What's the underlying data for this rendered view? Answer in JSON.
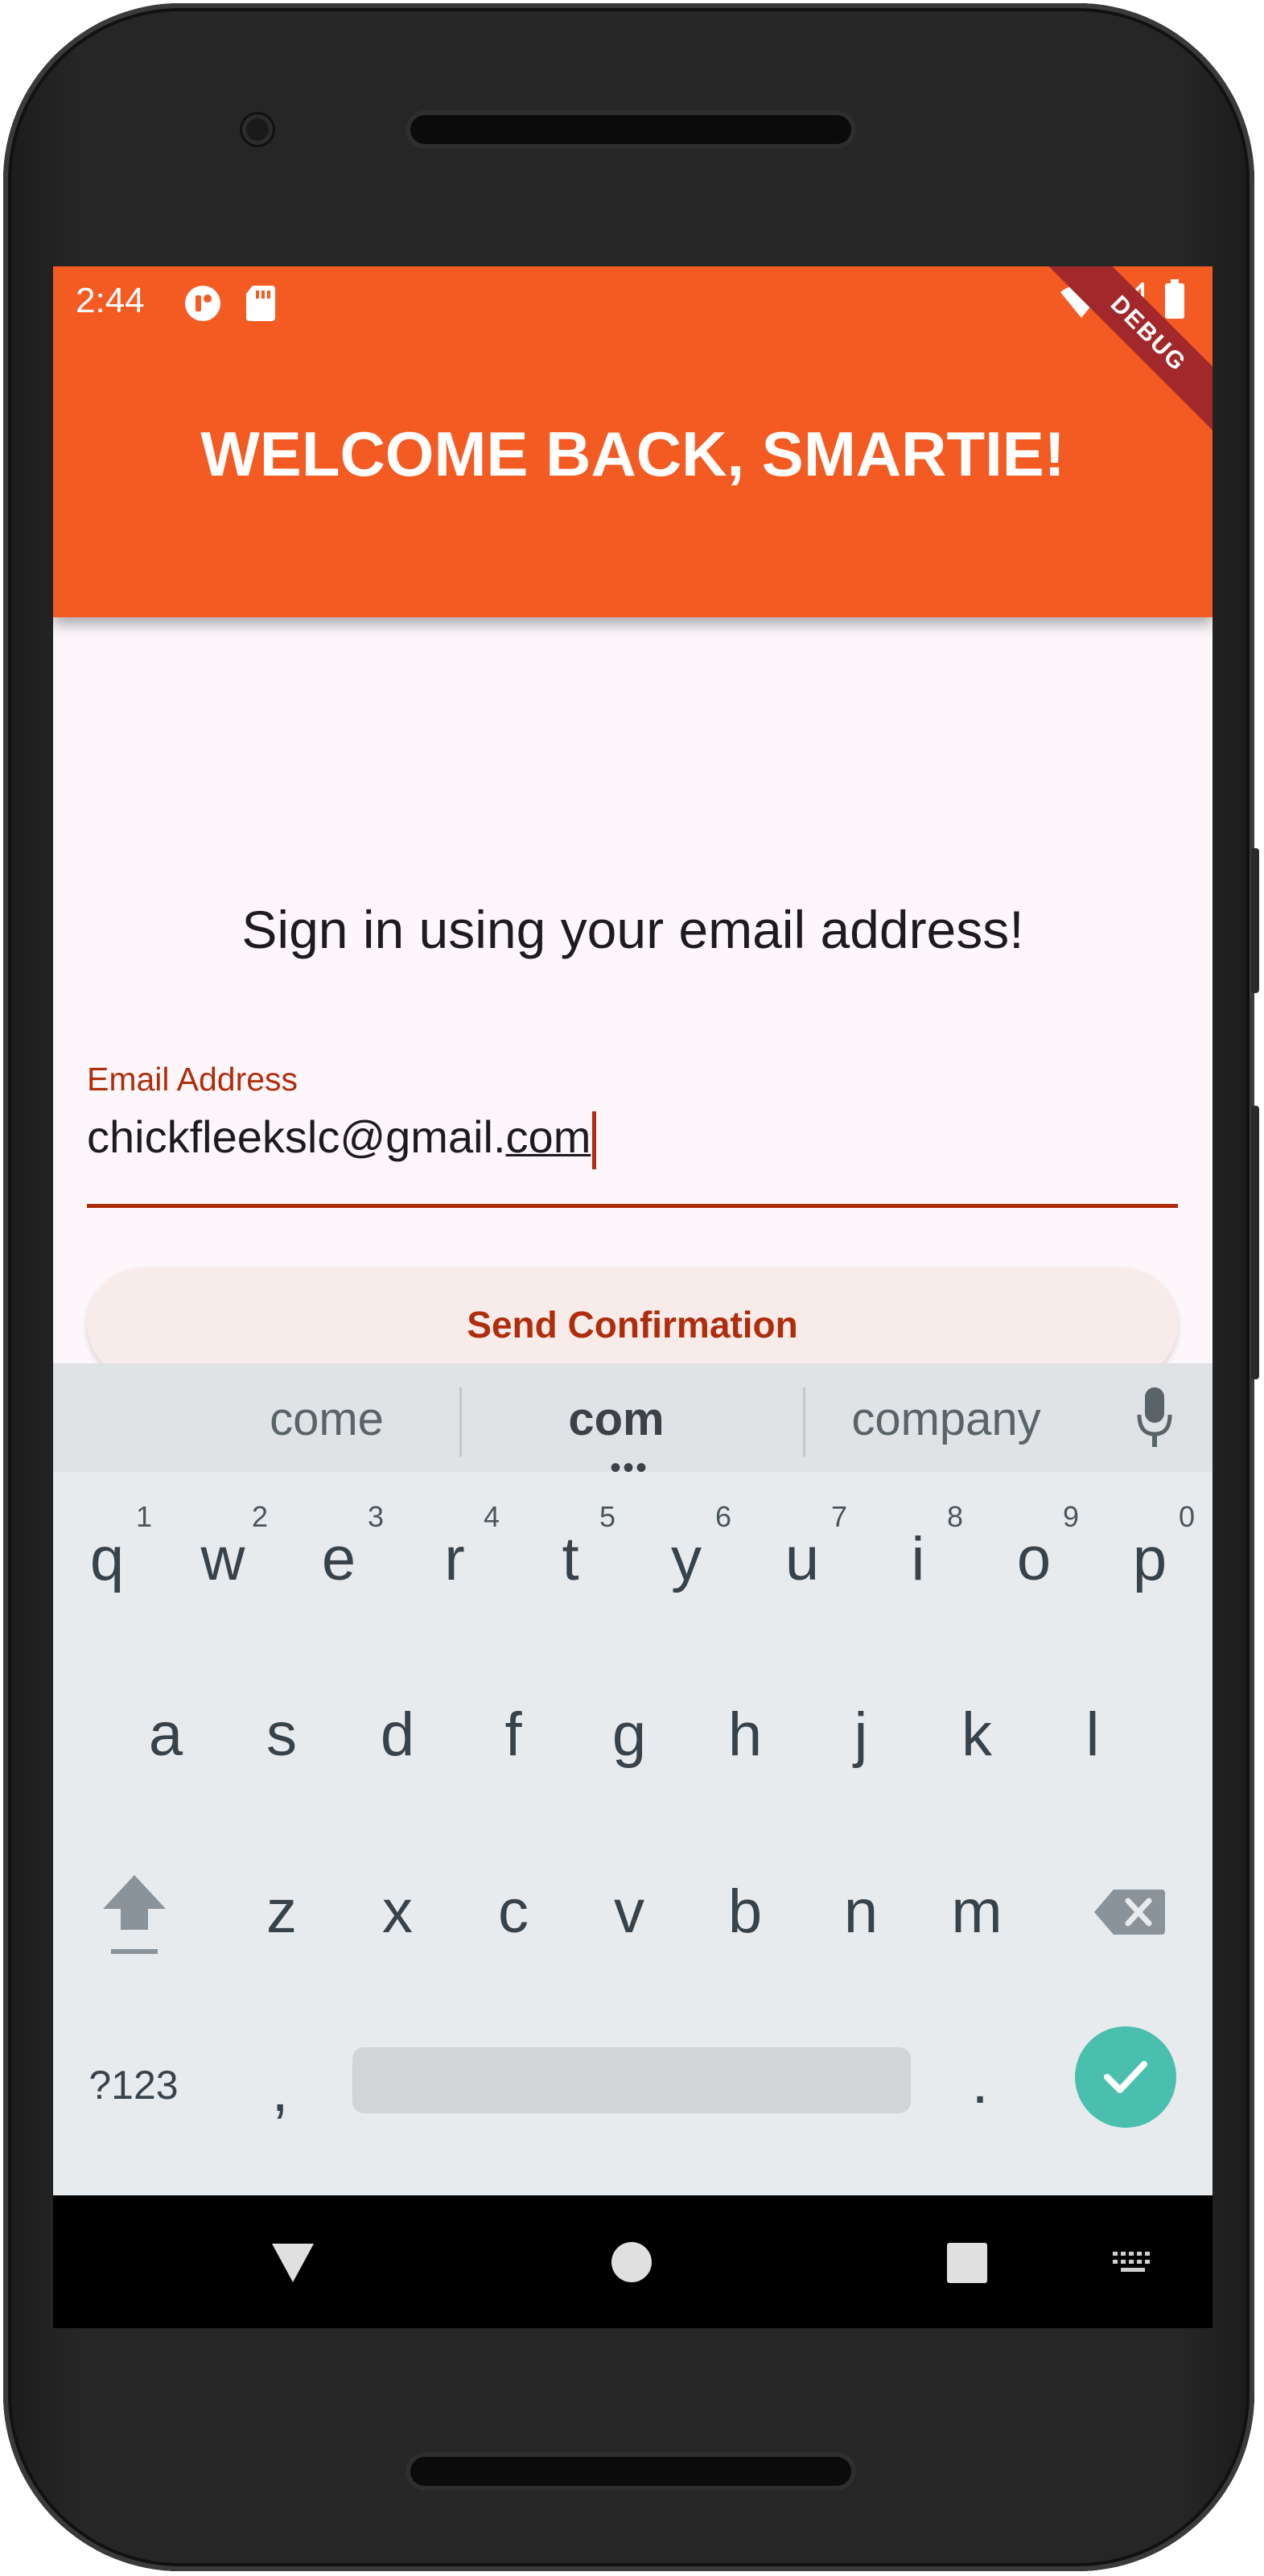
{
  "status_bar": {
    "time": "2:44",
    "icons": [
      "notification-app-icon",
      "sd-card-icon",
      "wifi-icon",
      "signal-icon",
      "battery-icon"
    ],
    "debug_banner": "DEBUG"
  },
  "app_bar": {
    "title": "WELCOME BACK, SMARTIE!",
    "background_color": "#f45b23"
  },
  "content": {
    "prompt": "Sign in using your email address!",
    "email_field": {
      "label": "Email Address",
      "value_prefix": "chickfleekslc@gmail.",
      "value_composing": "com"
    },
    "send_button": {
      "label": "Send Confirmation"
    },
    "accent_color": "#b02d0c"
  },
  "keyboard": {
    "suggestions": [
      "come",
      "com",
      "company"
    ],
    "row1": [
      "q",
      "w",
      "e",
      "r",
      "t",
      "y",
      "u",
      "i",
      "o",
      "p"
    ],
    "row1_hints": [
      "1",
      "2",
      "3",
      "4",
      "5",
      "6",
      "7",
      "8",
      "9",
      "0"
    ],
    "row2": [
      "a",
      "s",
      "d",
      "f",
      "g",
      "h",
      "j",
      "k",
      "l"
    ],
    "row3": [
      "z",
      "x",
      "c",
      "v",
      "b",
      "n",
      "m"
    ],
    "bottom": {
      "symbols": "?123",
      "comma": ",",
      "period": "."
    },
    "enter_color": "#4bbfae"
  },
  "nav_bar": {
    "icons": [
      "back-triangle-icon",
      "home-circle-icon",
      "recents-square-icon",
      "keyboard-switch-icon"
    ]
  }
}
